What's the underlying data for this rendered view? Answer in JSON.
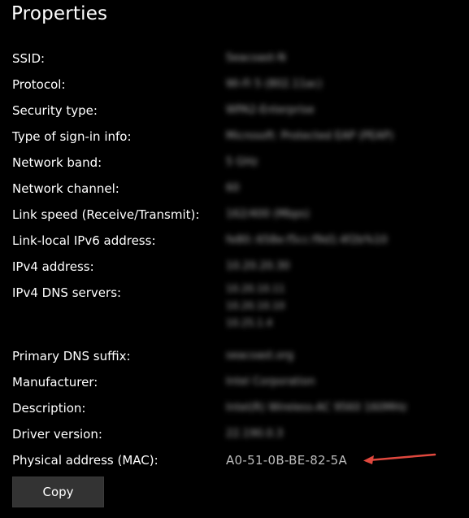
{
  "header": {
    "title": "Properties"
  },
  "properties": [
    {
      "label": "SSID:",
      "value": "Seacoast-N"
    },
    {
      "label": "Protocol:",
      "value": "Wi-Fi 5 (802.11ac)"
    },
    {
      "label": "Security type:",
      "value": "WPA2-Enterprise"
    },
    {
      "label": "Type of sign-in info:",
      "value": "Microsoft: Protected EAP (PEAP)"
    },
    {
      "label": "Network band:",
      "value": "5 GHz"
    },
    {
      "label": "Network channel:",
      "value": "60"
    },
    {
      "label": "Link speed (Receive/Transmit):",
      "value": "162/400 (Mbps)"
    },
    {
      "label": "Link-local IPv6 address:",
      "value": "fe80::658e:f5cc:f9d1:4f2b%10"
    },
    {
      "label": "IPv4 address:",
      "value": "10.20.20.30"
    },
    {
      "label": "IPv4 DNS servers:",
      "values": [
        "10.20.10.11",
        "10.20.10.10",
        "10.25.1.4"
      ]
    },
    {
      "label": "Primary DNS suffix:",
      "value": "seacoast.org"
    },
    {
      "label": "Manufacturer:",
      "value": "Intel Corporation"
    },
    {
      "label": "Description:",
      "value": "Intel(R) Wireless-AC 9560 160MHz"
    },
    {
      "label": "Driver version:",
      "value": "22.190.0.3"
    },
    {
      "label": "Physical address (MAC):",
      "value": "A0-51-0B-BE-82-5A"
    }
  ],
  "actions": {
    "copy_label": "Copy"
  },
  "colors": {
    "background": "#000000",
    "annotation_arrow": "#e0483e"
  }
}
